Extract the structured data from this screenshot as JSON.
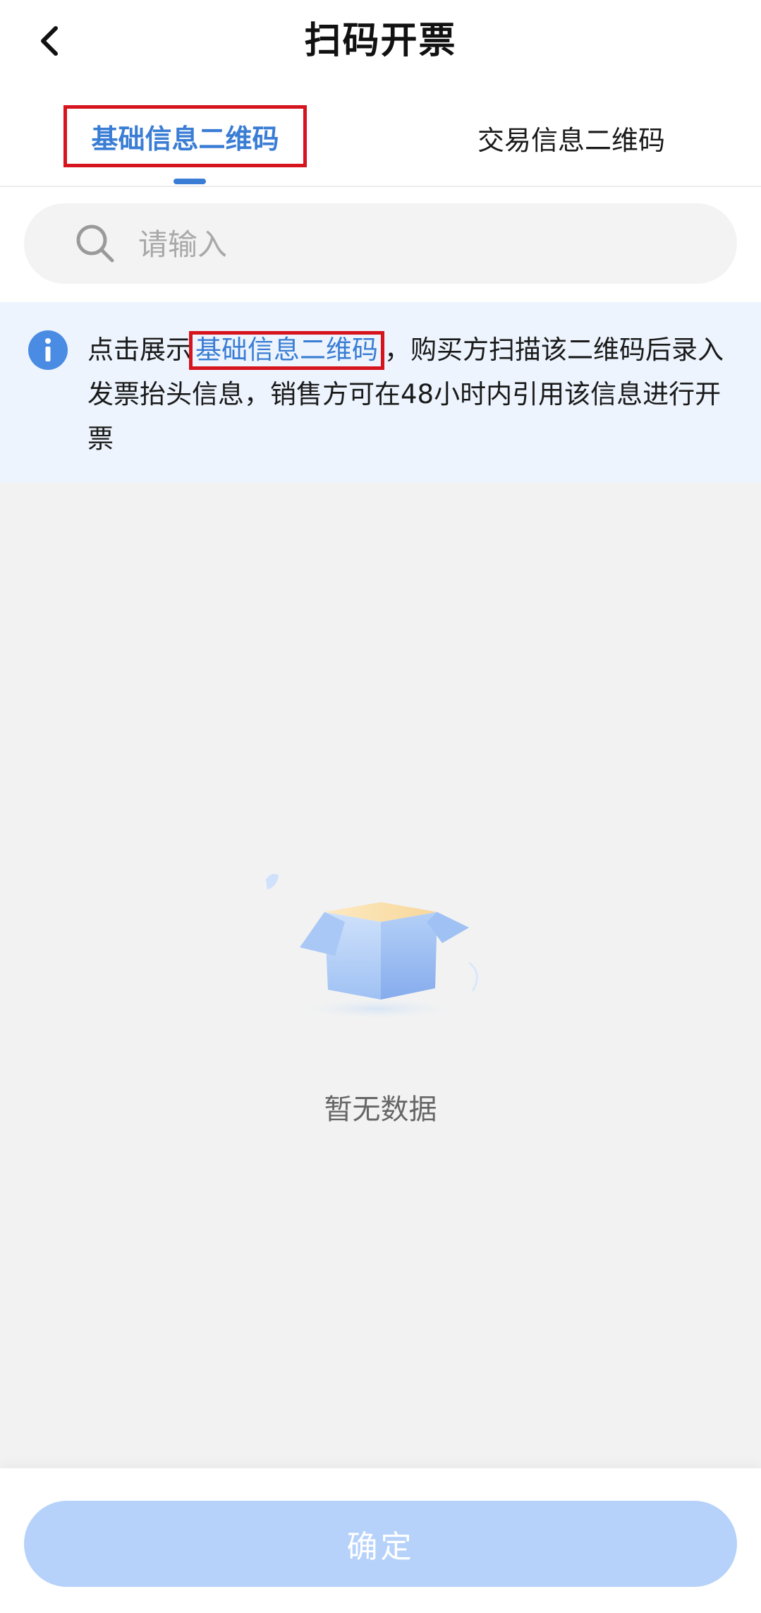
{
  "header": {
    "title": "扫码开票"
  },
  "tabs": [
    {
      "label": "基础信息二维码",
      "active": true
    },
    {
      "label": "交易信息二维码",
      "active": false
    }
  ],
  "search": {
    "placeholder": "请输入",
    "value": ""
  },
  "notice": {
    "prefix": "点击展示",
    "link": "基础信息二维码",
    "suffix": "，购买方扫描该二维码后录入发票抬头信息，销售方可在48小时内引用该信息进行开票"
  },
  "empty": {
    "text": "暂无数据"
  },
  "footer": {
    "confirm_label": "确定"
  },
  "colors": {
    "accent": "#3a7dd4",
    "highlight_border": "#d6141d",
    "notice_bg": "#edf4fd",
    "content_bg": "#f2f2f2",
    "confirm_disabled": "#b6d2fa"
  },
  "icons": {
    "back": "chevron-left-icon",
    "search": "search-icon",
    "info": "info-icon",
    "empty": "empty-box-illustration"
  }
}
